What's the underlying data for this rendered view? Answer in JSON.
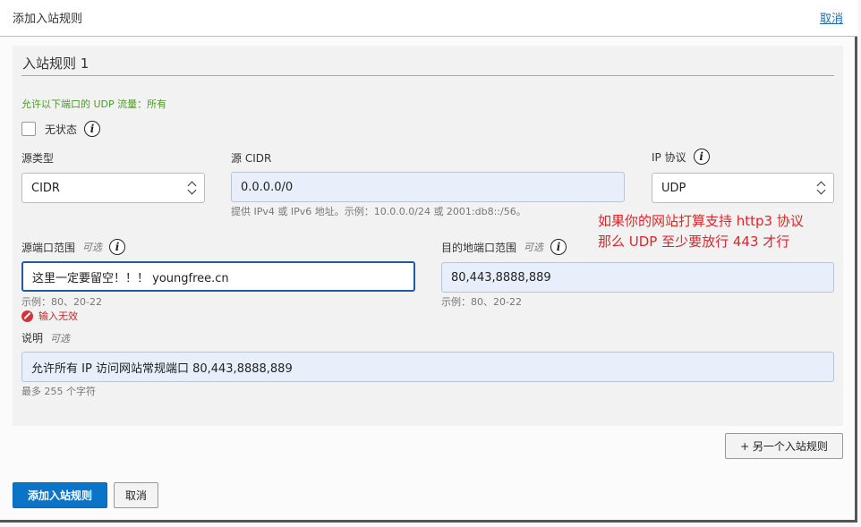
{
  "header": {
    "title": "添加入站规则",
    "cancel": "取消"
  },
  "rule": {
    "title": "入站规则 1",
    "note": "允许以下端口的 UDP 流量：所有",
    "stateless_label": "无状态",
    "source_type": {
      "label": "源类型",
      "value": "CIDR"
    },
    "source_cidr": {
      "label": "源 CIDR",
      "value": "0.0.0.0/0",
      "hint": "提供 IPv4 或 IPv6 地址。示例：10.0.0.0/24 或 2001:db8::/56。"
    },
    "ip_protocol": {
      "label": "IP 协议",
      "value": "UDP"
    },
    "source_port": {
      "label": "源端口范围",
      "optional": "可选",
      "value": "这里一定要留空！！！ youngfree.cn",
      "hint": "示例：80、20-22",
      "error": "输入无效"
    },
    "dest_port": {
      "label": "目的地端口范围",
      "optional": "可选",
      "value": "80,443,8888,889",
      "hint": "示例：80、20-22"
    },
    "description": {
      "label": "说明",
      "optional": "可选",
      "value": "允许所有 IP 访问网站常规端口 80,443,8888,889",
      "hint": "最多 255 个字符"
    }
  },
  "annotation": {
    "line1": "如果你的网站打算支持 http3 协议",
    "line2": "那么 UDP 至少要放行 443 才行"
  },
  "buttons": {
    "another_rule": "+ 另一个入站规则",
    "add_rules": "添加入站规则",
    "cancel": "取消"
  },
  "colors": {
    "primary": "#0a74c9",
    "annotation": "#e0242a",
    "note": "#4c9a2a",
    "error": "#c0292b"
  }
}
